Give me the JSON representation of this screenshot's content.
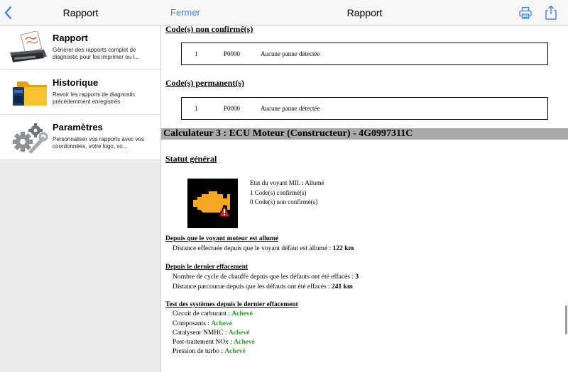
{
  "left_nav": {
    "title": "Rapport"
  },
  "menu": [
    {
      "title": "Rapport",
      "description": "Générer des rapports complet de diagnostic pour les imprimer ou l...",
      "icon": "printer-report-icon"
    },
    {
      "title": "Historique",
      "description": "Revoir les rapports de diagnostic précédemment enregistrés",
      "icon": "folder-history-icon"
    },
    {
      "title": "Paramètres",
      "description": "Personnaliser vos rapports avec vos coordonnées, votre logo, vo...",
      "icon": "gears-settings-icon"
    }
  ],
  "right_nav": {
    "close_label": "Fermer",
    "title": "Rapport"
  },
  "report": {
    "unconfirmed_heading": "Code(s) non confirmé(s)",
    "unconfirmed_row": {
      "index": "1",
      "code": "P0000",
      "text": "Aucune panne détectée"
    },
    "permanent_heading": "Code(s) permanent(s)",
    "permanent_row": {
      "index": "1",
      "code": "P0000",
      "text": "Aucune panne détectée"
    },
    "ecu_title": "Calculateur 3 : ECU Moteur (Constructeur) - 4G0997311C",
    "general_status_heading": "Statut général",
    "status_lines": [
      "Etat du voyant MIL : Allumé",
      "1 Code(s) confirmé(s)",
      "0 Code(s) non confirmé(s)"
    ],
    "mil_section": {
      "title": "Depuis que le voyant moteur est allumé",
      "lines": [
        {
          "label": "Distance effectuée depuis que le voyant défaut est allumé : ",
          "value": "122 km"
        }
      ]
    },
    "clear_section": {
      "title": "Depuis le dernier effacement",
      "lines": [
        {
          "label": "Nombre de cycle de chauffe depuis que les défauts ont été effacés : ",
          "value": "3"
        },
        {
          "label": "Distance parcourue depuis que les défauts ont été effacés : ",
          "value": "241 km"
        }
      ]
    },
    "tests_section": {
      "title": "Test des systèmes depuis le dernier effacement",
      "lines": [
        {
          "label": "Circuit de carburant : ",
          "value": "Achevé"
        },
        {
          "label": "Composants : ",
          "value": "Achevé"
        },
        {
          "label": "Catalyseur NMHC : ",
          "value": "Achevé"
        },
        {
          "label": "Post-traitement NOx : ",
          "value": "Achevé"
        },
        {
          "label": "Pression de turbo : ",
          "value": "Achevé"
        }
      ]
    }
  },
  "colors": {
    "accent": "#3a82f6",
    "success": "#2b9a2b",
    "engine_warning": "#f5a623",
    "alert": "#e02020",
    "ecu_bar": "#a9a9a9"
  }
}
